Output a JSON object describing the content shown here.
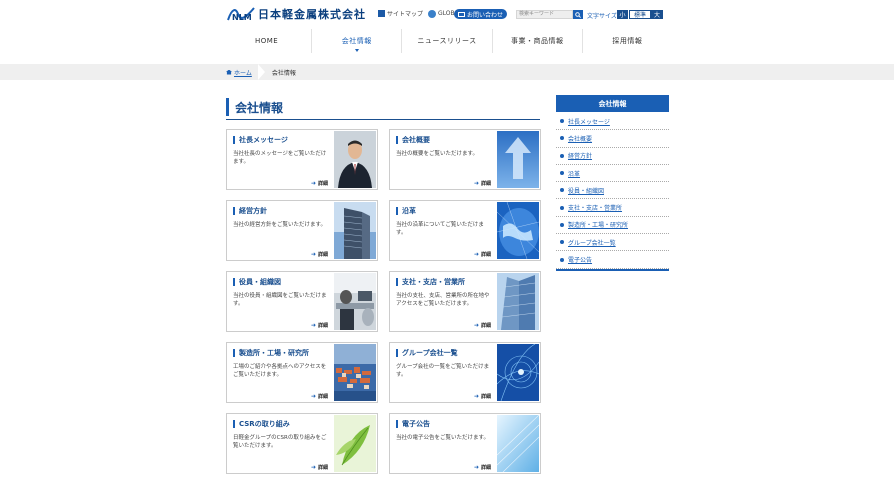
{
  "header": {
    "logo_text": "日本軽金属株式会社",
    "logo_mark": "NLM",
    "util_sitemap": "サイトマップ",
    "util_global": "GLOBAL",
    "contact_label": "お問い合わせ",
    "search_placeholder": "検索キーワード",
    "search_button_icon": "search-icon",
    "font_size_label": "文字サイズ",
    "font_small": "小",
    "font_medium": "標準",
    "font_large": "大"
  },
  "nav": {
    "items": [
      {
        "label": "HOME"
      },
      {
        "label": "会社情報"
      },
      {
        "label": "ニュースリリース"
      },
      {
        "label": "事業・商品情報"
      },
      {
        "label": "採用情報"
      }
    ],
    "active_index": 1
  },
  "breadcrumb": {
    "home": "ホーム",
    "current": "会社情報"
  },
  "page_title": "会社情報",
  "more_label": "詳細",
  "cards": [
    {
      "title": "社長メッセージ",
      "desc": "当社社長のメッセージをご覧いただけます。",
      "thumb": "portrait"
    },
    {
      "title": "会社概要",
      "desc": "当社の概要をご覧いただけます。",
      "thumb": "arrow"
    },
    {
      "title": "経営方針",
      "desc": "当社の経営方針をご覧いただけます。",
      "thumb": "building"
    },
    {
      "title": "沿革",
      "desc": "当社の沿革についてご覧いただけます。",
      "thumb": "globe"
    },
    {
      "title": "役員・組織図",
      "desc": "当社の役員・組織図をご覧いただけます。",
      "thumb": "office"
    },
    {
      "title": "支社・支店・営業所",
      "desc": "当社の支社、支店、営業所の所在地やアクセスをご覧いただけます。",
      "thumb": "skyscraper"
    },
    {
      "title": "製造所・工場・研究所",
      "desc": "工場のご紹介や各拠点へのアクセスをご覧いただけます。",
      "thumb": "town"
    },
    {
      "title": "グループ会社一覧",
      "desc": "グループ会社の一覧をご覧いただけます。",
      "thumb": "network"
    },
    {
      "title": "CSRの取り組み",
      "desc": "日軽金グループのCSRの取り組みをご覧いただけます。",
      "thumb": "leaf"
    },
    {
      "title": "電子公告",
      "desc": "当社の電子公告をご覧いただけます。",
      "thumb": "digital"
    }
  ],
  "sidebar": {
    "heading": "会社情報",
    "items": [
      {
        "label": "社長メッセージ"
      },
      {
        "label": "会社概要"
      },
      {
        "label": "経営方針"
      },
      {
        "label": "沿革"
      },
      {
        "label": "役員・組織図"
      },
      {
        "label": "支社・支店・営業所"
      },
      {
        "label": "製造所・工場・研究所"
      },
      {
        "label": "グループ会社一覧"
      },
      {
        "label": "電子公告"
      }
    ]
  },
  "colors": {
    "brand": "#1a5fb4",
    "brand_dark": "#1a4f8f"
  }
}
